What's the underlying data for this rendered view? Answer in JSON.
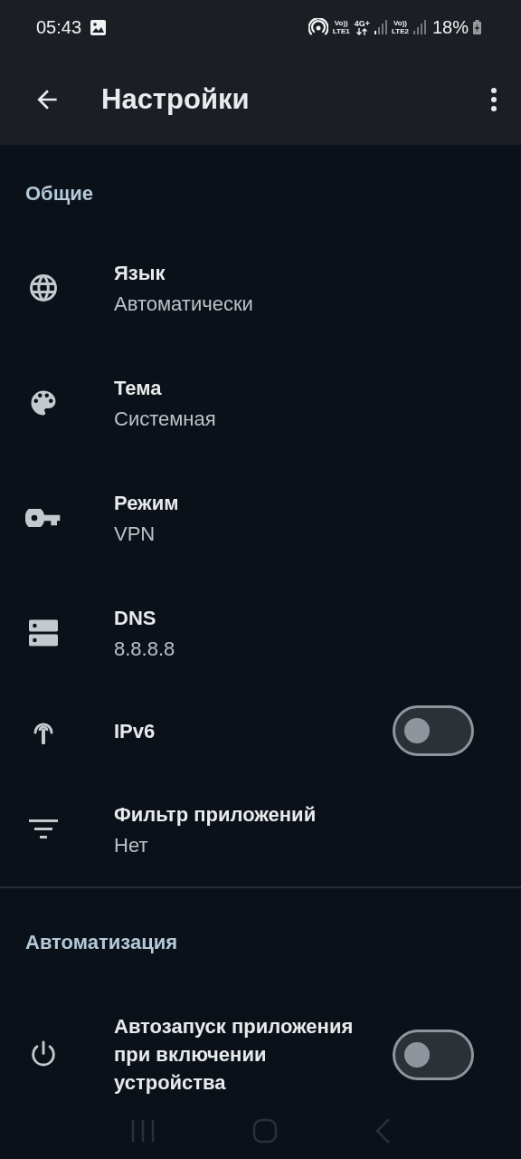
{
  "status_bar": {
    "time": "05:43",
    "sim1": {
      "top": "Vo))",
      "bottom": "LTE1"
    },
    "network": "4G+",
    "sim2": {
      "top": "Vo))",
      "bottom": "LTE2"
    },
    "battery": "18%"
  },
  "app_bar": {
    "title": "Настройки"
  },
  "sections": [
    {
      "title": "Общие",
      "items": [
        {
          "kind": "value",
          "title": "Язык",
          "value": "Автоматически"
        },
        {
          "kind": "value",
          "title": "Тема",
          "value": "Системная"
        },
        {
          "kind": "value",
          "title": "Режим",
          "value": "VPN"
        },
        {
          "kind": "value",
          "title": "DNS",
          "value": "8.8.8.8"
        },
        {
          "kind": "switch",
          "title": "IPv6",
          "on": false
        },
        {
          "kind": "value",
          "title": "Фильтр приложений",
          "value": "Нет"
        }
      ]
    },
    {
      "title": "Автоматизация",
      "items": [
        {
          "kind": "switch",
          "title": "Автозапуск приложения при включении устройства",
          "on": false
        }
      ]
    }
  ]
}
